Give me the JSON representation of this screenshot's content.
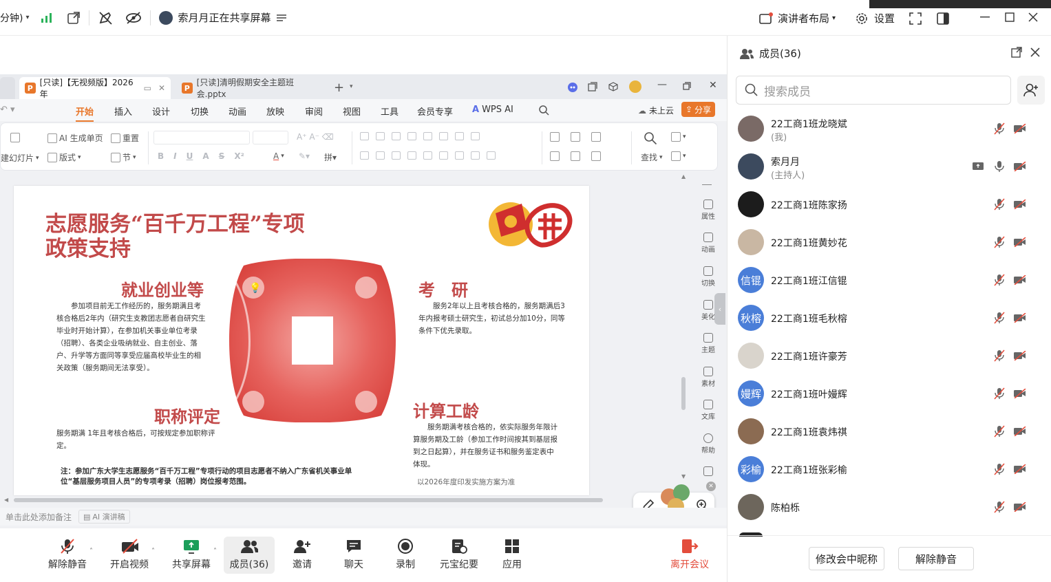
{
  "topbar": {
    "timer_fragment": "分钟)",
    "sharing_text": "索月月正在共享屏幕",
    "layout_label": "演讲者布局",
    "settings_label": "设置"
  },
  "wps": {
    "tabs": [
      {
        "label": "[只读]【无视频版】2026年"
      },
      {
        "label": "[只读]清明假期安全主题班会.pptx"
      }
    ],
    "menu": [
      "开始",
      "插入",
      "设计",
      "切换",
      "动画",
      "放映",
      "审阅",
      "视图",
      "工具",
      "会员专享",
      "WPS AI"
    ],
    "active_menu": "开始",
    "cloud_label": "未上云",
    "share_label": "分享",
    "ribbon": {
      "new_slide": "建幻灯片",
      "ai_page": "AI 生成单页",
      "reset": "重置",
      "layout": "版式",
      "section": "节",
      "find": "查找"
    },
    "rail": [
      "属性",
      "动画",
      "切换",
      "美化",
      "主题",
      "素材",
      "文库",
      "帮助"
    ],
    "notes_placeholder": "单击此处添加备注",
    "ai_speech": "AI 演讲稿"
  },
  "slide": {
    "title_line1": "志愿服务“百千万工程”专项",
    "title_line2": "政策支持",
    "s1_title": "就业创业等",
    "s1_body": "参加项目前无工作经历的，服务期满且考核合格后2年内（研究生支教团志愿者自研究生毕业时开始计算），在参加机关事业单位考录（招聘）、各类企业吸纳就业、自主创业、落户、升学等方面同等享受应届高校毕业生的相关政策（服务期间无法享受）。",
    "s2_title": "考　研",
    "s2_body": "服务2年以上且考核合格的，服务期满后3年内报考硕士研究生，初试总分加10分，同等条件下优先录取。",
    "s3_title": "职称评定",
    "s3_body": "服务期满 1年且考核合格后，可按规定参加职称评定。",
    "s4_title": "计算工龄",
    "s4_body": "服务期满考核合格的，依实际服务年限计算服务期及工龄（参加工作时间按其到基层报到之日起算），并在服务证书和服务鉴定表中体现。",
    "note": "注：参加广东大学生志愿服务“百千万工程”专项行动的项目志愿者不纳入广东省机关事业单位“基层服务项目人员”的专项考录（招聘）岗位报考范围。",
    "footnote": "以2026年度印发实施方案为准"
  },
  "bottombar": [
    {
      "label": "解除静音",
      "icon": "mic-muted-icon"
    },
    {
      "label": "开启视频",
      "icon": "video-off-icon"
    },
    {
      "label": "共享屏幕",
      "icon": "share-screen-icon"
    },
    {
      "label": "成员(36)",
      "icon": "members-icon"
    },
    {
      "label": "邀请",
      "icon": "invite-icon"
    },
    {
      "label": "聊天",
      "icon": "chat-icon"
    },
    {
      "label": "录制",
      "icon": "record-icon"
    },
    {
      "label": "元宝纪要",
      "icon": "notes-icon"
    },
    {
      "label": "应用",
      "icon": "apps-icon"
    }
  ],
  "leave_label": "离开会议",
  "panel": {
    "title": "成员(36)",
    "search_placeholder": "搜索成员",
    "members": [
      {
        "name": "22工商1班龙晓斌",
        "role": "(我)",
        "avatar_text": "",
        "avatar_color": "#7a6a66"
      },
      {
        "name": "索月月",
        "role": "(主持人)",
        "avatar_text": "",
        "avatar_color": "#3c4a5e"
      },
      {
        "name": "22工商1班陈家扬",
        "role": "",
        "avatar_text": "",
        "avatar_color": "#1c1c1c"
      },
      {
        "name": "22工商1班黄妙花",
        "role": "",
        "avatar_text": "",
        "avatar_color": "#c9b7a3"
      },
      {
        "name": "22工商1班江信锟",
        "role": "",
        "avatar_text": "信锟",
        "avatar_color": "#4a7ed8"
      },
      {
        "name": "22工商1班毛秋榕",
        "role": "",
        "avatar_text": "秋榕",
        "avatar_color": "#4a7ed8"
      },
      {
        "name": "22工商1班许豪芳",
        "role": "",
        "avatar_text": "",
        "avatar_color": "#d9d4cc"
      },
      {
        "name": "22工商1班叶嫚辉",
        "role": "",
        "avatar_text": "嫚辉",
        "avatar_color": "#4a7ed8"
      },
      {
        "name": "22工商1班袁炜祺",
        "role": "",
        "avatar_text": "",
        "avatar_color": "#8b6b52"
      },
      {
        "name": "22工商1班张彩榆",
        "role": "",
        "avatar_text": "彩榆",
        "avatar_color": "#4a7ed8"
      },
      {
        "name": "陈柏栎",
        "role": "",
        "avatar_text": "",
        "avatar_color": "#6d665c"
      }
    ],
    "rename_button": "修改会中昵称",
    "unmute_button": "解除静音"
  }
}
